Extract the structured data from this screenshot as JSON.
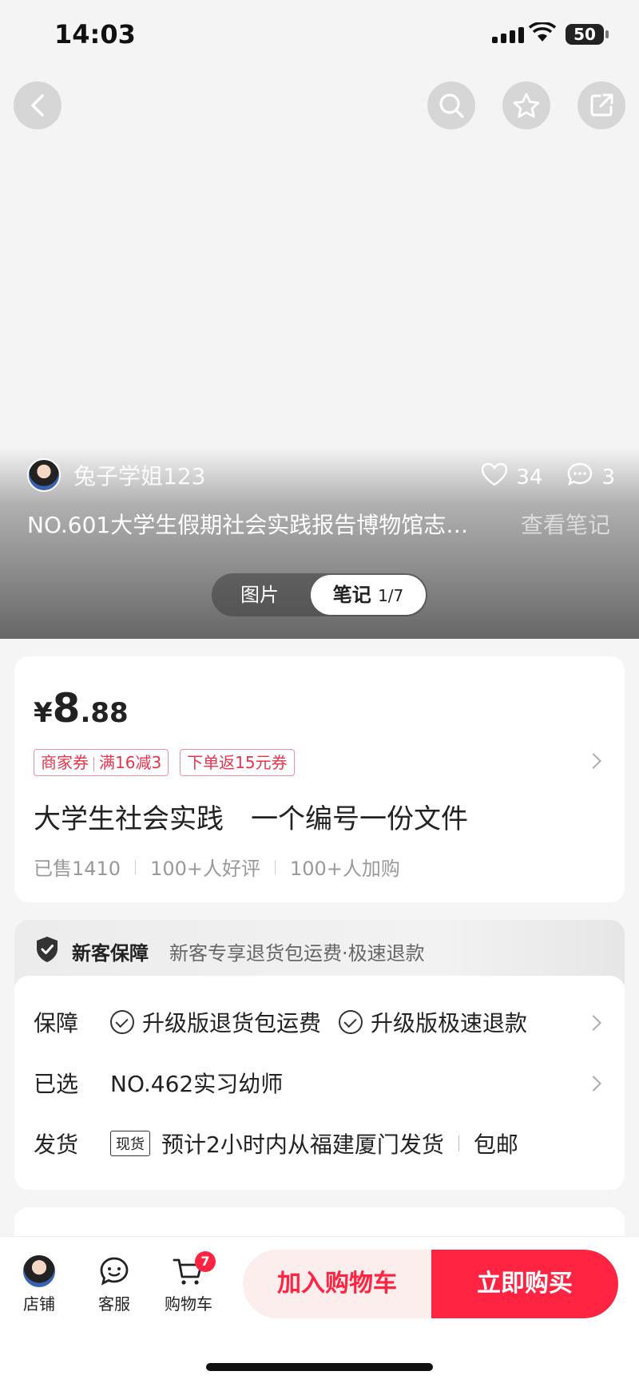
{
  "status_bar": {
    "time": "14:03",
    "battery": "50"
  },
  "hero": {
    "author_name": "兔子学姐123",
    "likes": "34",
    "comments": "3",
    "note_title": "NO.601大学生假期社会实践报告博物馆志…",
    "view_note": "查看笔记",
    "tabs": {
      "images": "图片",
      "notes": "笔记",
      "notes_count": "1/7"
    }
  },
  "product": {
    "currency": "¥",
    "price_int": "8",
    "price_dec": ".88",
    "coupon1_a": "商家券",
    "coupon1_b": "满16减3",
    "coupon2": "下单返15元券",
    "title": "大学生社会实践　一个编号一份文件",
    "sold": "已售1410",
    "good_reviews": "100+人好评",
    "added": "100+人加购"
  },
  "guarantee": {
    "head_title": "新客保障",
    "head_desc": "新客专享退货包运费·极速退款",
    "rows": {
      "protect_label": "保障",
      "protect_item1": "升级版退货包运费",
      "protect_item2": "升级版极速退款",
      "selected_label": "已选",
      "selected_value": "NO.462实习幼师",
      "ship_label": "发货",
      "ship_tag": "现货",
      "ship_value": "预计2小时内从福建厦门发货",
      "ship_free": "包邮"
    }
  },
  "bottom_bar": {
    "shop": "店铺",
    "service": "客服",
    "cart": "购物车",
    "cart_count": "7",
    "add_to_cart": "加入购物车",
    "buy_now": "立即购买"
  },
  "colors": {
    "accent": "#ff2442",
    "coupon": "#e8334d"
  }
}
